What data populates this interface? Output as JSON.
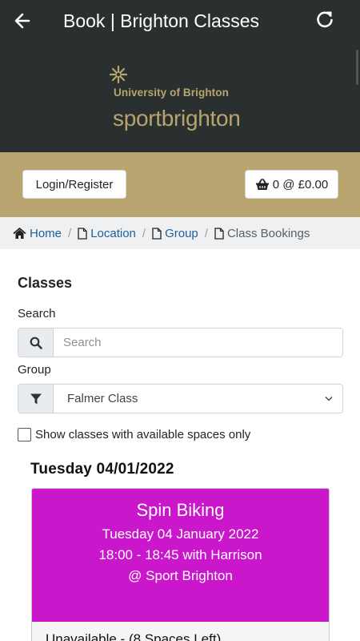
{
  "appbar": {
    "title": "Book | Brighton Classes",
    "back_icon": "arrow-left-icon",
    "refresh_icon": "refresh-icon"
  },
  "logo": {
    "university": "University of Brighton",
    "sport_prefix": "sport",
    "sport_suffix": "brighton",
    "color": "#b8a46e"
  },
  "header_buttons": {
    "login_label": "Login/Register",
    "basket_label": "0 @ £0.00",
    "basket_icon": "basket-icon"
  },
  "breadcrumb": [
    {
      "label": "Home",
      "icon": "home-icon"
    },
    {
      "label": "Location",
      "icon": "file-icon"
    },
    {
      "label": "Group",
      "icon": "file-icon"
    },
    {
      "label": "Class Bookings",
      "icon": "file-icon"
    }
  ],
  "separator": "/",
  "classes": {
    "heading": "Classes",
    "search_label": "Search",
    "search_placeholder": "Search",
    "search_value": "",
    "group_label": "Group",
    "group_selected": "Falmer Class",
    "available_only_label": "Show classes with available spaces only",
    "available_only_checked": false
  },
  "day": {
    "heading": "Tuesday 04/01/2022",
    "card": {
      "name": "Spin Biking",
      "date": "Tuesday 04 January 2022",
      "time_instructor": "18:00 - 18:45 with Harrison",
      "location": "@ Sport Brighton",
      "status": "Unavailable - (8 Spaces Left)",
      "color": "#cb17cb"
    }
  },
  "colors": {
    "appbar": "#2a2f2f",
    "gold": "#b9a56f",
    "link": "#1f5f97"
  }
}
